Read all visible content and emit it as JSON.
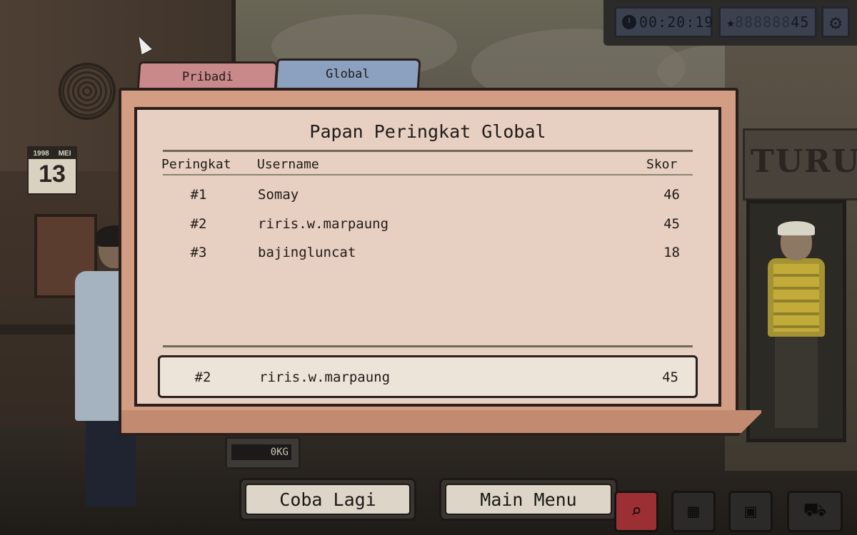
{
  "hud": {
    "timer_icon": "clock-icon",
    "timer": "00:20:19",
    "score_icon": "star-icon",
    "score_dim": "888888",
    "score": "45",
    "settings_icon": "gear-icon"
  },
  "tabs": [
    {
      "label": "Pribadi",
      "active": false
    },
    {
      "label": "Global",
      "active": true
    }
  ],
  "leaderboard": {
    "title": "Papan Peringkat Global",
    "columns": {
      "rank": "Peringkat",
      "username": "Username",
      "score": "Skor"
    },
    "rows": [
      {
        "rank": "#1",
        "username": "Somay",
        "score": "46"
      },
      {
        "rank": "#2",
        "username": "riris.w.marpaung",
        "score": "45"
      },
      {
        "rank": "#3",
        "username": "bajingluncat",
        "score": "18"
      }
    ],
    "current_player": {
      "rank": "#2",
      "username": "riris.w.marpaung",
      "score": "45"
    }
  },
  "buttons": {
    "retry": "Coba Lagi",
    "main_menu": "Main Menu"
  },
  "scene": {
    "calendar_year": "1998",
    "calendar_month": "MEI",
    "calendar_day": "13",
    "store_sign": "TURUN",
    "scale_readout": "0KG"
  },
  "toolbar": [
    "magnifier-icon",
    "calculator-icon",
    "cash-register-icon",
    "car-icon"
  ],
  "colors": {
    "tab_personal": "#c9888a",
    "tab_global": "#8ca0c0",
    "paper": "#e7cfc1",
    "folder": "#d29d82"
  }
}
